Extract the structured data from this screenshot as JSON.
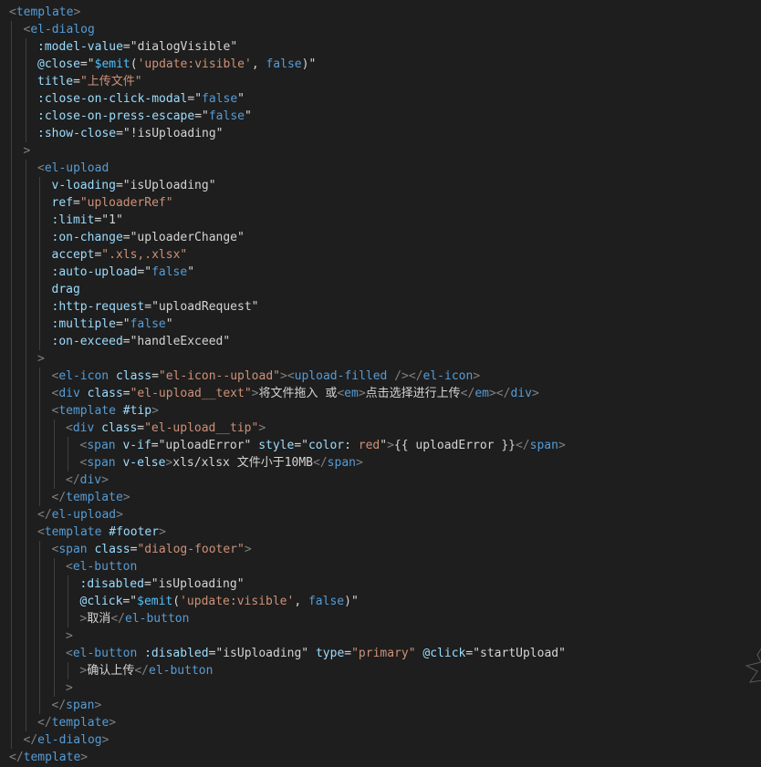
{
  "editor": {
    "lines": [
      {
        "indent": 0,
        "tokens": [
          [
            "x",
            "<"
          ],
          [
            "t",
            "template"
          ],
          [
            "x",
            ">"
          ]
        ]
      },
      {
        "indent": 1,
        "tokens": [
          [
            "x",
            "<"
          ],
          [
            "t",
            "el-dialog"
          ]
        ]
      },
      {
        "indent": 2,
        "tokens": [
          [
            "a",
            ":model-value"
          ],
          [
            "e",
            "="
          ],
          [
            "b",
            "\"dialogVisible\""
          ]
        ]
      },
      {
        "indent": 2,
        "tokens": [
          [
            "a",
            "@close"
          ],
          [
            "e",
            "="
          ],
          [
            "b",
            "\""
          ],
          [
            "v",
            "$emit"
          ],
          [
            "e",
            "("
          ],
          [
            "s",
            "'update:visible'"
          ],
          [
            "e",
            ", "
          ],
          [
            "t",
            "false"
          ],
          [
            "e",
            ")"
          ],
          [
            "b",
            "\""
          ]
        ]
      },
      {
        "indent": 2,
        "tokens": [
          [
            "a",
            "title"
          ],
          [
            "e",
            "="
          ],
          [
            "s",
            "\"上传文件\""
          ]
        ]
      },
      {
        "indent": 2,
        "tokens": [
          [
            "a",
            ":close-on-click-modal"
          ],
          [
            "e",
            "="
          ],
          [
            "b",
            "\""
          ],
          [
            "t",
            "false"
          ],
          [
            "b",
            "\""
          ]
        ]
      },
      {
        "indent": 2,
        "tokens": [
          [
            "a",
            ":close-on-press-escape"
          ],
          [
            "e",
            "="
          ],
          [
            "b",
            "\""
          ],
          [
            "t",
            "false"
          ],
          [
            "b",
            "\""
          ]
        ]
      },
      {
        "indent": 2,
        "tokens": [
          [
            "a",
            ":show-close"
          ],
          [
            "e",
            "="
          ],
          [
            "b",
            "\"!isUploading\""
          ]
        ]
      },
      {
        "indent": 1,
        "tokens": [
          [
            "x",
            ">"
          ]
        ]
      },
      {
        "indent": 2,
        "tokens": [
          [
            "x",
            "<"
          ],
          [
            "t",
            "el-upload"
          ]
        ]
      },
      {
        "indent": 3,
        "tokens": [
          [
            "a",
            "v-loading"
          ],
          [
            "e",
            "="
          ],
          [
            "b",
            "\"isUploading\""
          ]
        ]
      },
      {
        "indent": 3,
        "tokens": [
          [
            "a",
            "ref"
          ],
          [
            "e",
            "="
          ],
          [
            "s",
            "\"uploaderRef\""
          ]
        ]
      },
      {
        "indent": 3,
        "tokens": [
          [
            "a",
            ":limit"
          ],
          [
            "e",
            "="
          ],
          [
            "b",
            "\"1\""
          ]
        ]
      },
      {
        "indent": 3,
        "tokens": [
          [
            "a",
            ":on-change"
          ],
          [
            "e",
            "="
          ],
          [
            "b",
            "\"uploaderChange\""
          ]
        ]
      },
      {
        "indent": 3,
        "tokens": [
          [
            "a",
            "accept"
          ],
          [
            "e",
            "="
          ],
          [
            "s",
            "\".xls,.xlsx\""
          ]
        ]
      },
      {
        "indent": 3,
        "tokens": [
          [
            "a",
            ":auto-upload"
          ],
          [
            "e",
            "="
          ],
          [
            "b",
            "\""
          ],
          [
            "t",
            "false"
          ],
          [
            "b",
            "\""
          ]
        ]
      },
      {
        "indent": 3,
        "tokens": [
          [
            "a",
            "drag"
          ]
        ]
      },
      {
        "indent": 3,
        "tokens": [
          [
            "a",
            ":http-request"
          ],
          [
            "e",
            "="
          ],
          [
            "b",
            "\"uploadRequest\""
          ]
        ]
      },
      {
        "indent": 3,
        "tokens": [
          [
            "a",
            ":multiple"
          ],
          [
            "e",
            "="
          ],
          [
            "b",
            "\""
          ],
          [
            "t",
            "false"
          ],
          [
            "b",
            "\""
          ]
        ]
      },
      {
        "indent": 3,
        "tokens": [
          [
            "a",
            ":on-exceed"
          ],
          [
            "e",
            "="
          ],
          [
            "b",
            "\"handleExceed\""
          ]
        ]
      },
      {
        "indent": 2,
        "tokens": [
          [
            "x",
            ">"
          ]
        ]
      },
      {
        "indent": 3,
        "tokens": [
          [
            "x",
            "<"
          ],
          [
            "t",
            "el-icon"
          ],
          [
            "e",
            " "
          ],
          [
            "a",
            "class"
          ],
          [
            "e",
            "="
          ],
          [
            "s",
            "\"el-icon--upload\""
          ],
          [
            "x",
            ">"
          ],
          [
            "x",
            "<"
          ],
          [
            "t",
            "upload-filled"
          ],
          [
            "e",
            " "
          ],
          [
            "x",
            "/>"
          ],
          [
            "x",
            "</"
          ],
          [
            "t",
            "el-icon"
          ],
          [
            "x",
            ">"
          ]
        ]
      },
      {
        "indent": 3,
        "tokens": [
          [
            "x",
            "<"
          ],
          [
            "t",
            "div"
          ],
          [
            "e",
            " "
          ],
          [
            "a",
            "class"
          ],
          [
            "e",
            "="
          ],
          [
            "s",
            "\"el-upload__text\""
          ],
          [
            "x",
            ">"
          ],
          [
            "w",
            "将文件拖入 或"
          ],
          [
            "x",
            "<"
          ],
          [
            "t",
            "em"
          ],
          [
            "x",
            ">"
          ],
          [
            "w",
            "点击选择进行上传"
          ],
          [
            "x",
            "</"
          ],
          [
            "t",
            "em"
          ],
          [
            "x",
            ">"
          ],
          [
            "x",
            "</"
          ],
          [
            "t",
            "div"
          ],
          [
            "x",
            ">"
          ]
        ]
      },
      {
        "indent": 3,
        "tokens": [
          [
            "x",
            "<"
          ],
          [
            "t",
            "template"
          ],
          [
            "e",
            " "
          ],
          [
            "a",
            "#tip"
          ],
          [
            "x",
            ">"
          ]
        ]
      },
      {
        "indent": 4,
        "tokens": [
          [
            "x",
            "<"
          ],
          [
            "t",
            "div"
          ],
          [
            "e",
            " "
          ],
          [
            "a",
            "class"
          ],
          [
            "e",
            "="
          ],
          [
            "s",
            "\"el-upload__tip\""
          ],
          [
            "x",
            ">"
          ]
        ]
      },
      {
        "indent": 5,
        "tokens": [
          [
            "x",
            "<"
          ],
          [
            "t",
            "span"
          ],
          [
            "e",
            " "
          ],
          [
            "a",
            "v-if"
          ],
          [
            "e",
            "="
          ],
          [
            "b",
            "\"uploadError\""
          ],
          [
            "e",
            " "
          ],
          [
            "a",
            "style"
          ],
          [
            "e",
            "="
          ],
          [
            "b",
            "\""
          ],
          [
            "a",
            "color"
          ],
          [
            "e",
            ": "
          ],
          [
            "s",
            "red"
          ],
          [
            "b",
            "\""
          ],
          [
            "x",
            ">"
          ],
          [
            "w",
            "{{ "
          ],
          [
            "b",
            "uploadError"
          ],
          [
            "w",
            " }}"
          ],
          [
            "x",
            "</"
          ],
          [
            "t",
            "span"
          ],
          [
            "x",
            ">"
          ]
        ]
      },
      {
        "indent": 5,
        "tokens": [
          [
            "x",
            "<"
          ],
          [
            "t",
            "span"
          ],
          [
            "e",
            " "
          ],
          [
            "a",
            "v-else"
          ],
          [
            "x",
            ">"
          ],
          [
            "w",
            "xls/xlsx 文件小于10MB"
          ],
          [
            "x",
            "</"
          ],
          [
            "t",
            "span"
          ],
          [
            "x",
            ">"
          ]
        ]
      },
      {
        "indent": 4,
        "tokens": [
          [
            "x",
            "</"
          ],
          [
            "t",
            "div"
          ],
          [
            "x",
            ">"
          ]
        ]
      },
      {
        "indent": 3,
        "tokens": [
          [
            "x",
            "</"
          ],
          [
            "t",
            "template"
          ],
          [
            "x",
            ">"
          ]
        ]
      },
      {
        "indent": 2,
        "tokens": [
          [
            "x",
            "</"
          ],
          [
            "t",
            "el-upload"
          ],
          [
            "x",
            ">"
          ]
        ]
      },
      {
        "indent": 2,
        "tokens": [
          [
            "x",
            "<"
          ],
          [
            "t",
            "template"
          ],
          [
            "e",
            " "
          ],
          [
            "a",
            "#footer"
          ],
          [
            "x",
            ">"
          ]
        ]
      },
      {
        "indent": 3,
        "tokens": [
          [
            "x",
            "<"
          ],
          [
            "t",
            "span"
          ],
          [
            "e",
            " "
          ],
          [
            "a",
            "class"
          ],
          [
            "e",
            "="
          ],
          [
            "s",
            "\"dialog-footer\""
          ],
          [
            "x",
            ">"
          ]
        ]
      },
      {
        "indent": 4,
        "tokens": [
          [
            "x",
            "<"
          ],
          [
            "t",
            "el-button"
          ]
        ]
      },
      {
        "indent": 5,
        "tokens": [
          [
            "a",
            ":disabled"
          ],
          [
            "e",
            "="
          ],
          [
            "b",
            "\"isUploading\""
          ]
        ]
      },
      {
        "indent": 5,
        "tokens": [
          [
            "a",
            "@click"
          ],
          [
            "e",
            "="
          ],
          [
            "b",
            "\""
          ],
          [
            "v",
            "$emit"
          ],
          [
            "e",
            "("
          ],
          [
            "s",
            "'update:visible'"
          ],
          [
            "e",
            ", "
          ],
          [
            "t",
            "false"
          ],
          [
            "e",
            ")"
          ],
          [
            "b",
            "\""
          ]
        ]
      },
      {
        "indent": 5,
        "tokens": [
          [
            "x",
            ">"
          ],
          [
            "w",
            "取消"
          ],
          [
            "x",
            "</"
          ],
          [
            "t",
            "el-button"
          ]
        ]
      },
      {
        "indent": 4,
        "tokens": [
          [
            "x",
            ">"
          ]
        ]
      },
      {
        "indent": 4,
        "tokens": [
          [
            "x",
            "<"
          ],
          [
            "t",
            "el-button"
          ],
          [
            "e",
            " "
          ],
          [
            "a",
            ":disabled"
          ],
          [
            "e",
            "="
          ],
          [
            "b",
            "\"isUploading\""
          ],
          [
            "e",
            " "
          ],
          [
            "a",
            "type"
          ],
          [
            "e",
            "="
          ],
          [
            "s",
            "\"primary\""
          ],
          [
            "e",
            " "
          ],
          [
            "a",
            "@click"
          ],
          [
            "e",
            "="
          ],
          [
            "b",
            "\"startUpload\""
          ]
        ]
      },
      {
        "indent": 5,
        "tokens": [
          [
            "x",
            ">"
          ],
          [
            "w",
            "确认上传"
          ],
          [
            "x",
            "</"
          ],
          [
            "t",
            "el-button"
          ]
        ]
      },
      {
        "indent": 4,
        "tokens": [
          [
            "x",
            ">"
          ]
        ]
      },
      {
        "indent": 3,
        "tokens": [
          [
            "x",
            "</"
          ],
          [
            "t",
            "span"
          ],
          [
            "x",
            ">"
          ]
        ]
      },
      {
        "indent": 2,
        "tokens": [
          [
            "x",
            "</"
          ],
          [
            "t",
            "template"
          ],
          [
            "x",
            ">"
          ]
        ]
      },
      {
        "indent": 1,
        "tokens": [
          [
            "x",
            "</"
          ],
          [
            "t",
            "el-dialog"
          ],
          [
            "x",
            ">"
          ]
        ]
      },
      {
        "indent": 0,
        "tokens": [
          [
            "x",
            "</"
          ],
          [
            "t",
            "template"
          ],
          [
            "x",
            ">"
          ]
        ]
      }
    ]
  },
  "colors": {
    "background": "#1e1e1e",
    "tag": "#569cd6",
    "attribute": "#9cdcfe",
    "string": "#ce9178",
    "bracket": "#808080",
    "text": "#d4d4d4",
    "variable": "#4fc1ff"
  },
  "decoration": {
    "icon": "spark-icon"
  }
}
